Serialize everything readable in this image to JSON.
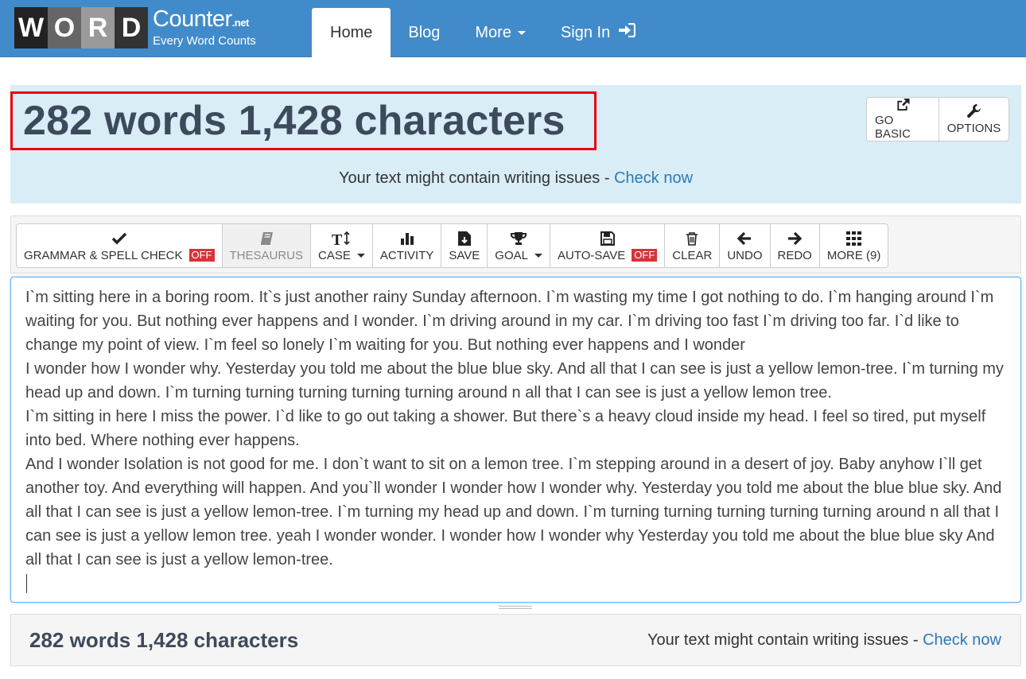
{
  "brand": {
    "tiles": [
      "W",
      "O",
      "R",
      "D"
    ],
    "name": "Counter",
    "domain_suffix": ".net",
    "tagline": "Every Word Counts"
  },
  "nav": {
    "home": "Home",
    "blog": "Blog",
    "more": "More",
    "signin": "Sign In"
  },
  "stats": {
    "summary": "282 words 1,428 characters",
    "issues_prefix": "Your text might contain writing issues - ",
    "issues_link": "Check now"
  },
  "panel_buttons": {
    "go_basic": "GO BASIC",
    "options": "OPTIONS"
  },
  "toolbar": {
    "grammar": "GRAMMAR & SPELL CHECK",
    "grammar_state": "OFF",
    "thesaurus": "THESAURUS",
    "case": "CASE",
    "activity": "ACTIVITY",
    "save": "SAVE",
    "goal": "GOAL",
    "autosave": "AUTO-SAVE",
    "autosave_state": "OFF",
    "clear": "CLEAR",
    "undo": "UNDO",
    "redo": "REDO",
    "more": "MORE (9)"
  },
  "editor": {
    "text": "I`m sitting here in a boring room. It`s just another rainy Sunday afternoon. I`m wasting my time I got nothing to do. I`m hanging around I`m waiting for you. But nothing ever happens and I wonder. I`m driving around in my car. I`m driving too fast I`m driving too far. I`d like to change my point of view. I`m feel so lonely I`m waiting for you. But nothing ever happens and I wonder\nI wonder how I wonder why. Yesterday you told me about the blue blue sky. And all that I can see is just a yellow lemon-tree. I`m turning my head up and down. I`m turning turning turning turning turning around n all that I can see is just a yellow lemon tree.\nI`m sitting in here I miss the power. I`d like to go out taking a shower. But there`s a heavy cloud inside my head. I feel so tired, put myself into bed. Where nothing ever happens.\nAnd I wonder Isolation is not good for me. I don`t want to sit on a lemon tree. I`m stepping around in a desert of joy. Baby anyhow I`ll get another toy. And everything will happen. And you`ll wonder I wonder how I wonder why. Yesterday you told me about the blue blue sky. And all that I can see is just a yellow lemon-tree. I`m turning my head up and down. I`m turning turning turning turning turning around n all that I can see is just a yellow lemon tree. yeah I wonder wonder. I wonder how I wonder why Yesterday you told me about the blue blue sky And all that I can see is just a yellow lemon-tree."
  },
  "colors": {
    "navbar": "#428bca",
    "panel": "#d9edf7",
    "highlight_border": "#e8000b",
    "link": "#2a7ab7",
    "off_badge": "#d9333a"
  }
}
